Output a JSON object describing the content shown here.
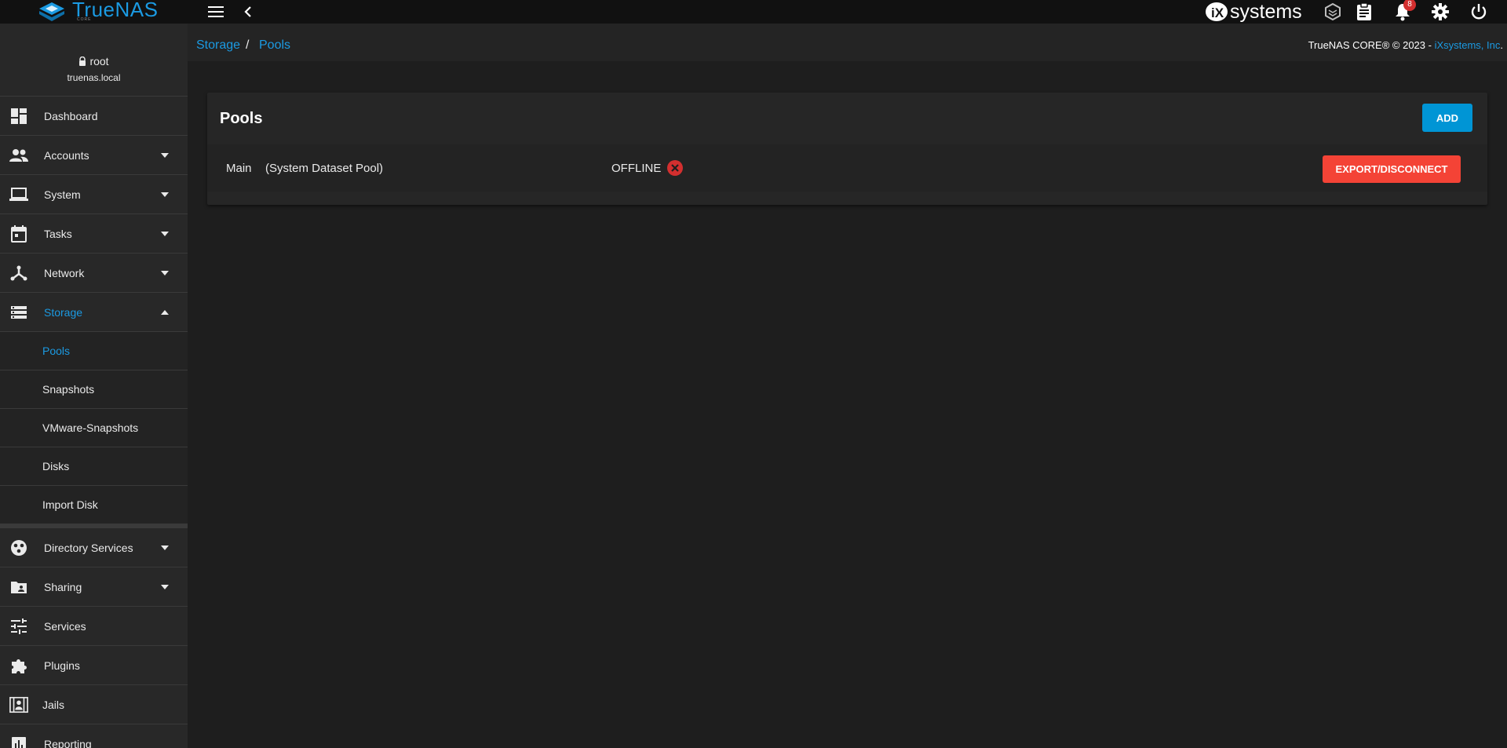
{
  "topbar": {
    "logo_text": "TrueNAS",
    "logo_sub": "CORE",
    "vendor_logo_text": "systems",
    "notification_count": "8"
  },
  "sidebar": {
    "user": "root",
    "host": "truenas.local",
    "items": [
      {
        "label": "Dashboard",
        "icon": "dashboard-icon",
        "expandable": false
      },
      {
        "label": "Accounts",
        "icon": "people-icon",
        "expandable": true
      },
      {
        "label": "System",
        "icon": "laptop-icon",
        "expandable": true
      },
      {
        "label": "Tasks",
        "icon": "calendar-icon",
        "expandable": true
      },
      {
        "label": "Network",
        "icon": "network-icon",
        "expandable": true
      },
      {
        "label": "Storage",
        "icon": "storage-icon",
        "expandable": true,
        "expanded": true
      }
    ],
    "storage_sub": [
      {
        "label": "Pools",
        "active": true
      },
      {
        "label": "Snapshots"
      },
      {
        "label": "VMware-Snapshots"
      },
      {
        "label": "Disks"
      },
      {
        "label": "Import Disk"
      }
    ],
    "items_after": [
      {
        "label": "Directory Services",
        "icon": "directory-icon",
        "expandable": true
      },
      {
        "label": "Sharing",
        "icon": "folder-share-icon",
        "expandable": true
      },
      {
        "label": "Services",
        "icon": "tune-icon",
        "expandable": false
      },
      {
        "label": "Plugins",
        "icon": "puzzle-icon",
        "expandable": false
      },
      {
        "label": "Jails",
        "icon": "jail-icon",
        "expandable": false
      },
      {
        "label": "Reporting",
        "icon": "chart-icon",
        "expandable": false
      }
    ]
  },
  "breadcrumb": {
    "root": "Storage",
    "sep": "/",
    "current": "Pools"
  },
  "copyright": {
    "text": "TrueNAS CORE® © 2023 - ",
    "link": "iXsystems, Inc",
    "end": "."
  },
  "pools_card": {
    "title": "Pools",
    "add_label": "ADD",
    "pool": {
      "name": "Main",
      "description": "(System Dataset Pool)",
      "status": "OFFLINE",
      "export_label": "EXPORT/DISCONNECT"
    }
  },
  "colors": {
    "accent": "#1b9ae2",
    "add_button": "#0095d5",
    "danger": "#f44336",
    "offline_icon": "#d32f2f"
  }
}
